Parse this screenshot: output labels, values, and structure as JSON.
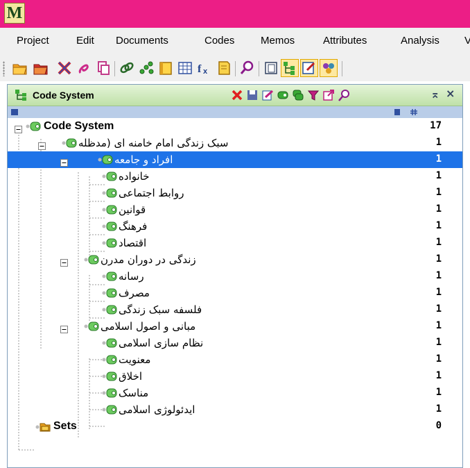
{
  "app": {
    "logo": "M"
  },
  "menubar": {
    "items": [
      {
        "label": "Project"
      },
      {
        "label": "Edit"
      },
      {
        "label": "Documents"
      },
      {
        "label": "Codes"
      },
      {
        "label": "Memos"
      },
      {
        "label": "Attributes"
      },
      {
        "label": "Analysis"
      },
      {
        "label": "V"
      }
    ]
  },
  "toolbar": {
    "icons": [
      "folder-open-icon",
      "folder-red-icon",
      "cross-icon",
      "document-link-icon",
      "copy-icon",
      "link-icon",
      "code-network-icon",
      "document-icon",
      "table-icon",
      "function-icon",
      "memo-icon",
      "search-icon",
      "window-icon",
      "code-tree-icon",
      "edit-icon",
      "tags-icon"
    ]
  },
  "panel": {
    "title": "Code System",
    "header_icons": [
      "cross-icon",
      "save-icon",
      "edit-icon",
      "code-icon",
      "codes-icon",
      "filter-icon",
      "export-icon",
      "search-icon"
    ],
    "pin_glyph": "⌅",
    "close_glyph": "×"
  },
  "tree": {
    "rows": [
      {
        "label": "Code System",
        "count": "17"
      },
      {
        "label": "سبک زندگی امام خامنه ای (مدظله",
        "count": "1"
      },
      {
        "label": "افراد و جامعه",
        "count": "1"
      },
      {
        "label": "خانواده",
        "count": "1"
      },
      {
        "label": "روابط اجتماعی",
        "count": "1"
      },
      {
        "label": "قوانین",
        "count": "1"
      },
      {
        "label": "فرهنگ",
        "count": "1"
      },
      {
        "label": "اقتصاد",
        "count": "1"
      },
      {
        "label": "زندگی در دوران مدرن",
        "count": "1"
      },
      {
        "label": "رسانه",
        "count": "1"
      },
      {
        "label": "مصرف",
        "count": "1"
      },
      {
        "label": "فلسفه سبک زندگی",
        "count": "1"
      },
      {
        "label": "مبانی و اصول اسلامی",
        "count": "1"
      },
      {
        "label": "نظام سازی اسلامی",
        "count": "1"
      },
      {
        "label": "معنویت",
        "count": "1"
      },
      {
        "label": "اخلاق",
        "count": "1"
      },
      {
        "label": "مناسک",
        "count": "1"
      },
      {
        "label": "ایدئولوژی اسلامی",
        "count": "1"
      },
      {
        "label": "Sets",
        "count": "0"
      }
    ]
  },
  "colors": {
    "titlebar": "#ec1e86",
    "selection": "#1e73e8",
    "panel_header": "#cfe8bc",
    "code_icon": "#3aaa35"
  }
}
